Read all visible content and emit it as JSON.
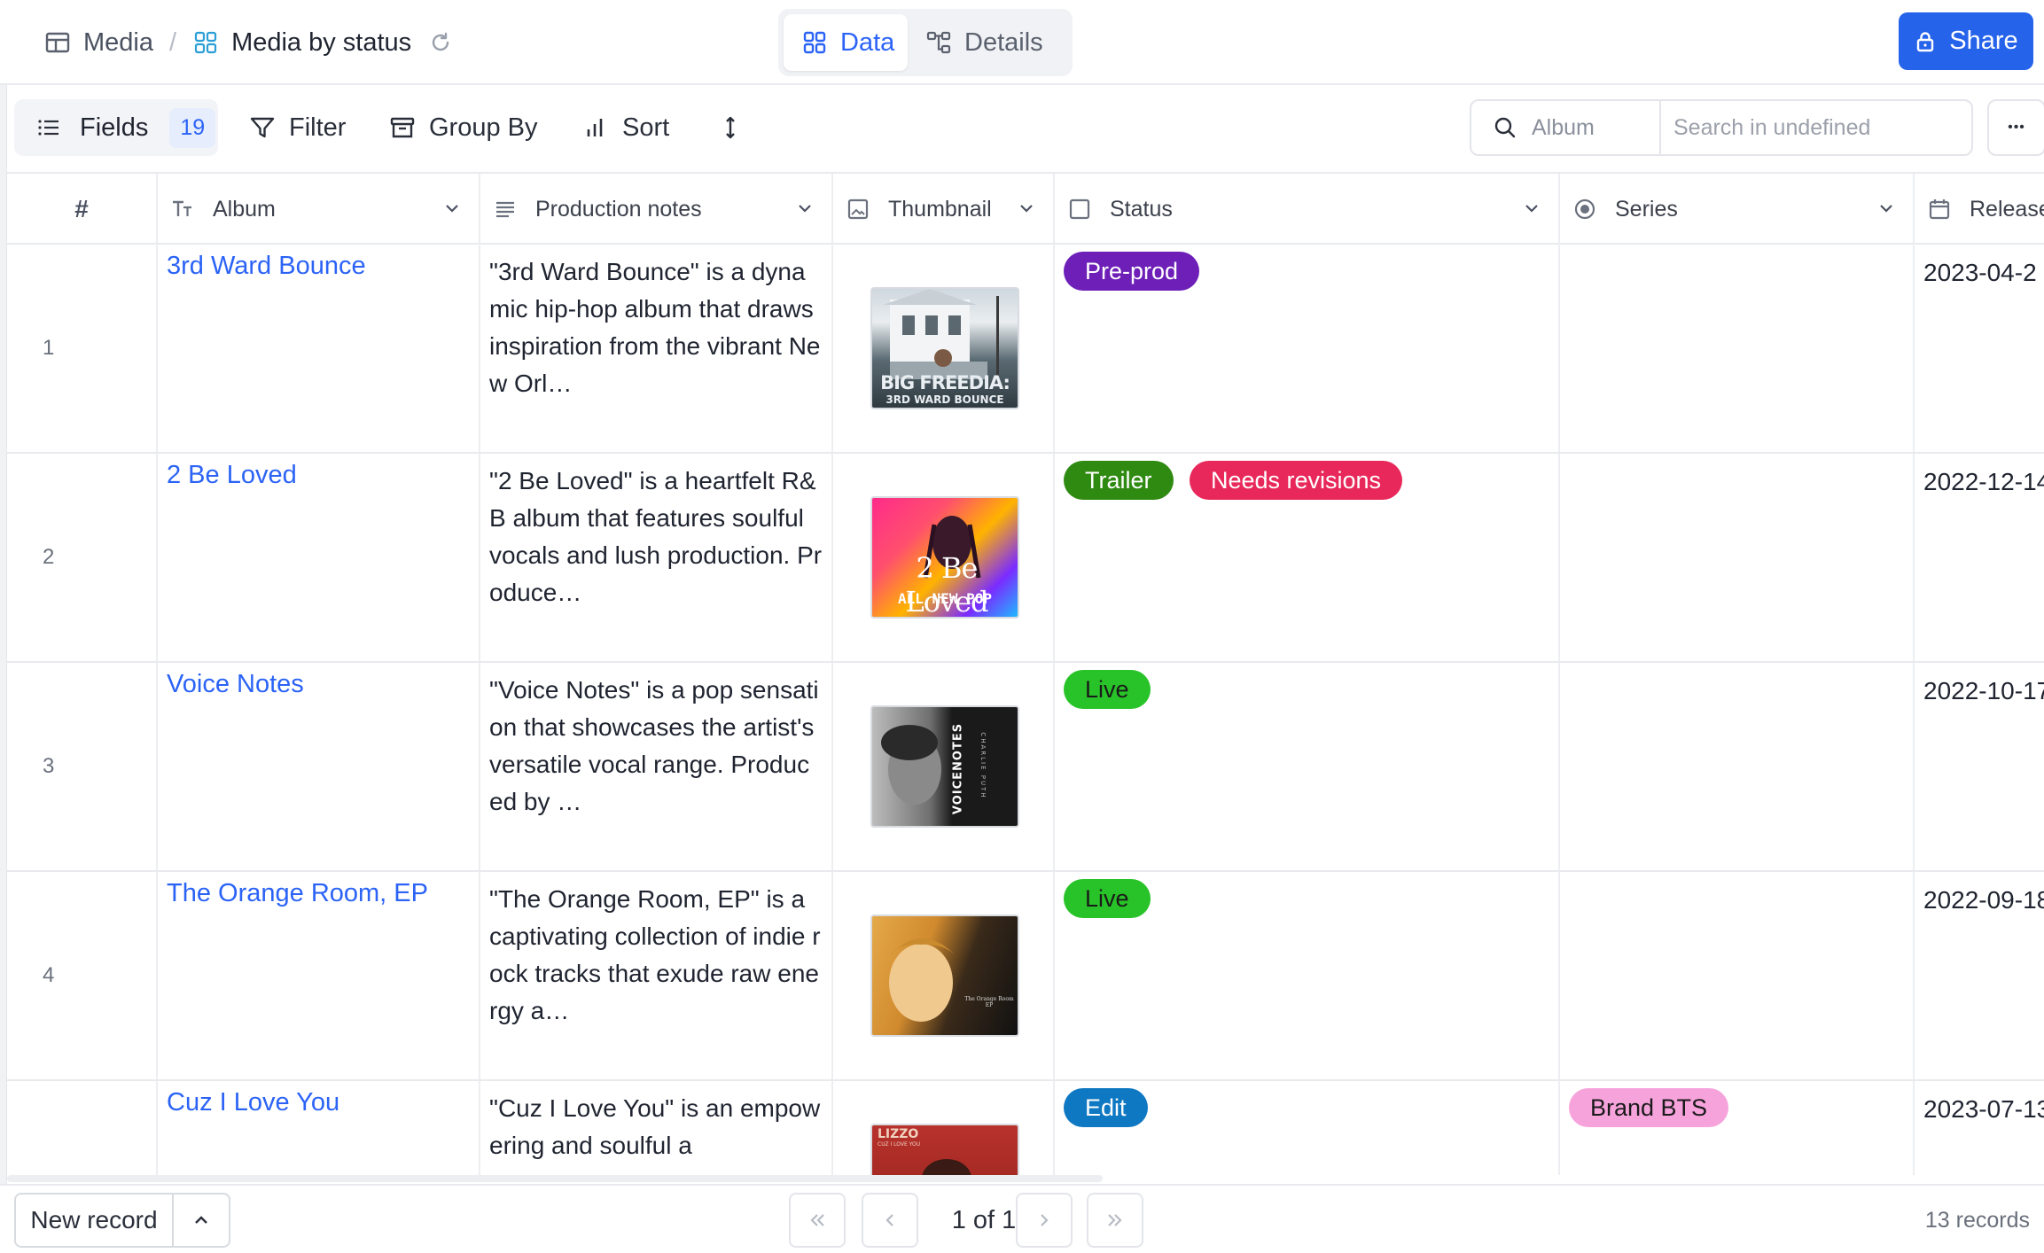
{
  "header": {
    "breadcrumb_base": "Media",
    "breadcrumb_separator": "/",
    "breadcrumb_current": "Media by status",
    "view_tabs": [
      {
        "label": "Data",
        "active": true,
        "icon": "grid-icon"
      },
      {
        "label": "Details",
        "active": false,
        "icon": "hierarchy-icon"
      }
    ],
    "share_label": "Share",
    "accent_color": "#2563eb"
  },
  "toolbar": {
    "fields_label": "Fields",
    "fields_count": "19",
    "filter_label": "Filter",
    "group_label": "Group By",
    "sort_label": "Sort",
    "search_field": "Album",
    "search_placeholder": "Search in undefined",
    "more_label": "•••"
  },
  "columns": {
    "num": "#",
    "album": "Album",
    "notes": "Production notes",
    "thumbnail": "Thumbnail",
    "status": "Status",
    "series": "Series",
    "release": "Release"
  },
  "rows": [
    {
      "num": "1",
      "album": "3rd Ward Bounce",
      "notes": "\"3rd Ward Bounce\" is a dynamic hip-hop album that draws inspiration from the vibrant New Orl…",
      "thumbnail": {
        "title": "BIG FREEDIA:",
        "subtitle": "3RD WARD BOUNCE"
      },
      "status": [
        {
          "label": "Pre-prod",
          "color": "#6d1fb8",
          "text_color": "#ffffff"
        }
      ],
      "series": [],
      "release": "2023-04-2"
    },
    {
      "num": "2",
      "album": "2 Be Loved",
      "notes": "\"2 Be Loved\" is a heartfelt R&B album that features soulful vocals and lush production. Produce…",
      "thumbnail": {
        "title": "2 Be Loved",
        "subtitle": "ALL NEW POP"
      },
      "status": [
        {
          "label": "Trailer",
          "color": "#2f8a12",
          "text_color": "#ffffff"
        },
        {
          "label": "Needs revisions",
          "color": "#e8285a",
          "text_color": "#ffffff"
        }
      ],
      "series": [],
      "release": "2022-12-14"
    },
    {
      "num": "3",
      "album": "Voice Notes",
      "notes": "\"Voice Notes\" is a pop sensation that showcases the artist's versatile vocal range. Produced by …",
      "thumbnail": {
        "title": "VOICENOTES",
        "subtitle": "CHARLIE PUTH"
      },
      "status": [
        {
          "label": "Live",
          "color": "#28c328",
          "text_color": "#1a1a1a"
        }
      ],
      "series": [],
      "release": "2022-10-17"
    },
    {
      "num": "4",
      "album": "The Orange Room, EP",
      "notes": "\"The Orange Room, EP\" is a captivating collection of indie rock tracks that exude raw energy a…",
      "thumbnail": {
        "title": "The Orange Room EP",
        "subtitle": ""
      },
      "status": [
        {
          "label": "Live",
          "color": "#28c328",
          "text_color": "#1a1a1a"
        }
      ],
      "series": [],
      "release": "2022-09-18"
    },
    {
      "num": "",
      "album": "Cuz I Love You",
      "notes": "\"Cuz I Love You\" is an empowering and soulful a",
      "thumbnail": {
        "title": "LIZZO",
        "subtitle": "CUZ I LOVE YOU"
      },
      "status": [
        {
          "label": "Edit",
          "color": "#0f78c2",
          "text_color": "#ffffff"
        }
      ],
      "series": [
        {
          "label": "Brand BTS",
          "color": "#f6a3dc",
          "text_color": "#1a1a1a"
        }
      ],
      "release": "2023-07-13"
    }
  ],
  "footer": {
    "new_record_label": "New record",
    "page_label": "1 of 1",
    "records_label": "13 records"
  }
}
